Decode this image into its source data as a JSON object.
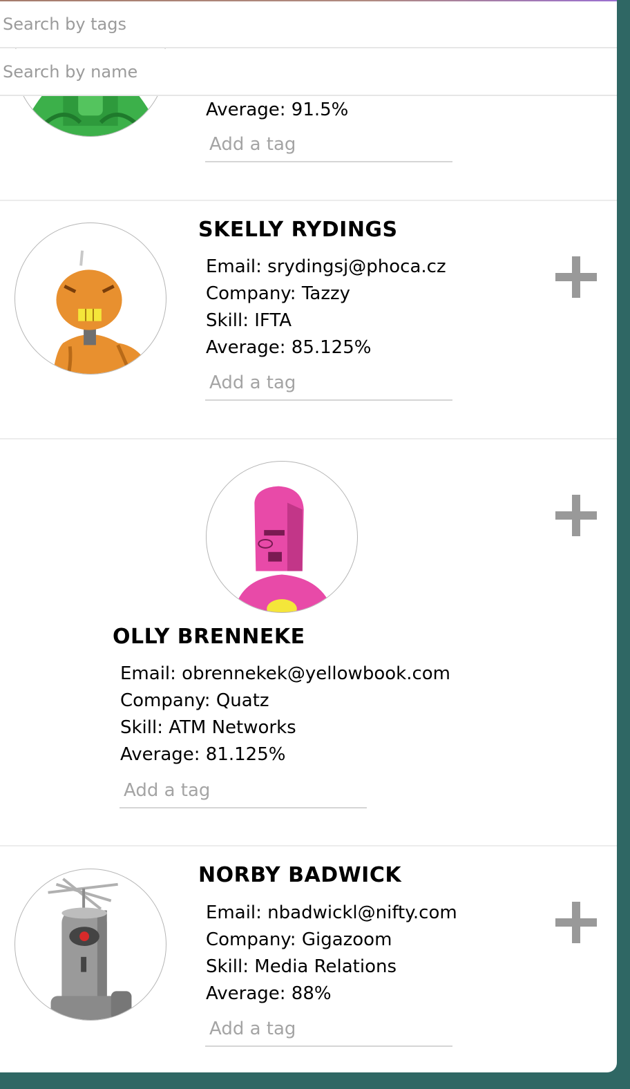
{
  "search": {
    "tags_placeholder": "Search by tags",
    "name_placeholder": "Search by name"
  },
  "students": [
    {
      "average": "Average: 91.5%",
      "tag_placeholder": "Add a tag",
      "avatar_color": "#3cb04a"
    },
    {
      "name": "SKELLY RYDINGS",
      "email": "Email: srydingsj@phoca.cz",
      "company": "Company: Tazzy",
      "skill": "Skill: IFTA",
      "average": "Average: 85.125%",
      "tag_placeholder": "Add a tag",
      "avatar_color": "#e8902f"
    },
    {
      "name": "OLLY BRENNEKE",
      "email": "Email: obrennekek@yellowbook.com",
      "company": "Company: Quatz",
      "skill": "Skill: ATM Networks",
      "average": "Average: 81.125%",
      "tag_placeholder": "Add a tag",
      "avatar_color": "#e84aa8"
    },
    {
      "name": "NORBY BADWICK",
      "email": "Email: nbadwickl@nifty.com",
      "company": "Company: Gigazoom",
      "skill": "Skill: Media Relations",
      "average": "Average: 88%",
      "tag_placeholder": "Add a tag",
      "avatar_color": "#9a9a9a"
    }
  ],
  "icons": {
    "expand": "plus-icon"
  },
  "colors": {
    "background": "#2f6764",
    "card": "#ffffff",
    "plus": "#999999"
  }
}
